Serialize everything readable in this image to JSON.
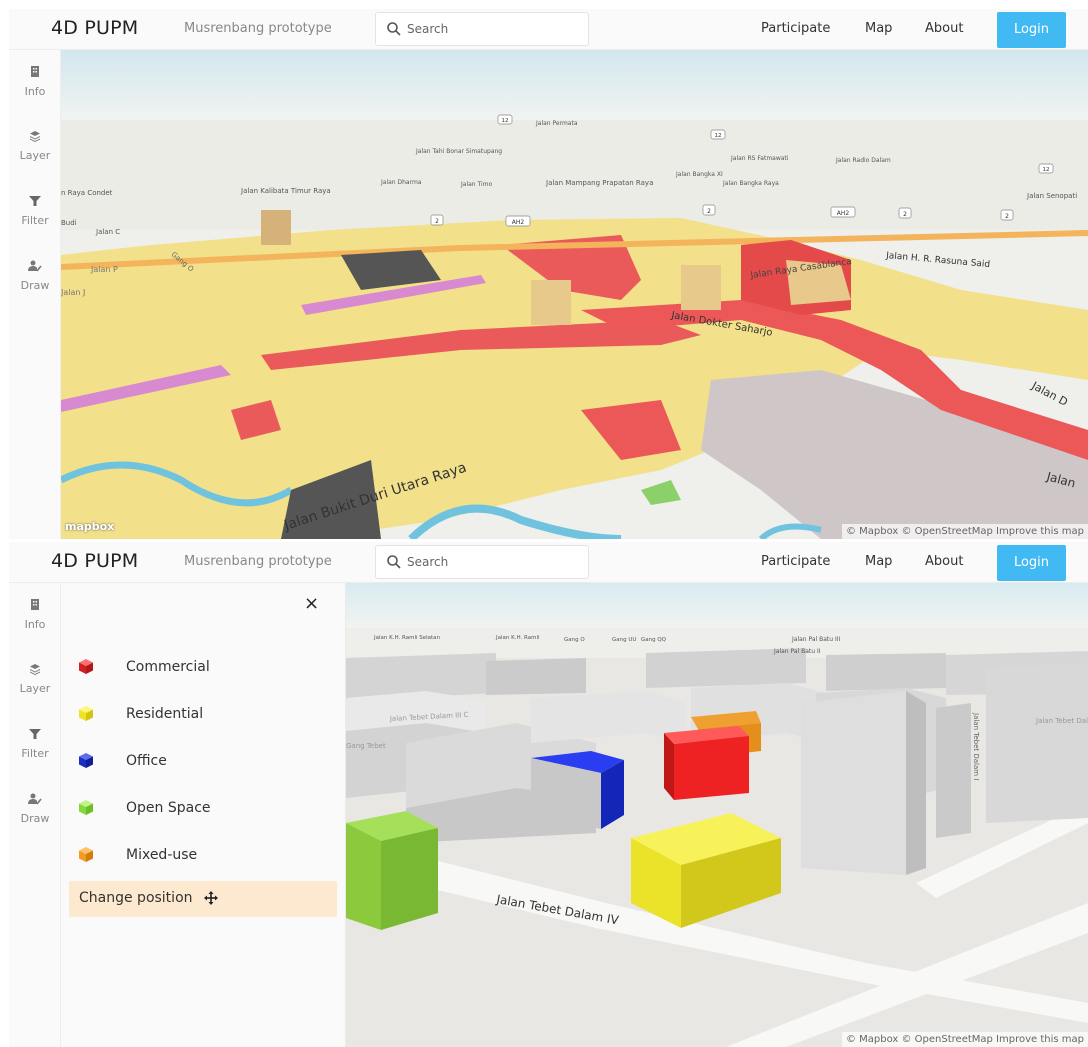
{
  "navbar": {
    "brand": "4D PUPM",
    "subtitle": "Musrenbang prototype",
    "search_placeholder": "Search",
    "links": [
      "Participate",
      "Map",
      "About"
    ],
    "login_label": "Login"
  },
  "sidebar": {
    "items": [
      {
        "label": "Info",
        "icon": "building-icon"
      },
      {
        "label": "Layer",
        "icon": "layers-icon"
      },
      {
        "label": "Filter",
        "icon": "filter-icon"
      },
      {
        "label": "Draw",
        "icon": "user-edit-icon"
      }
    ]
  },
  "map_top": {
    "street_labels": [
      "Jalan Permata",
      "Jalan Tahi Bonar Simatupang",
      "Jalan RS Fatmawati",
      "Jalan Radio Dalam",
      "Jalan Kalibata Timur Raya",
      "Jalan Dharma",
      "Jalan Timo",
      "Jalan Mampang Prapatan Raya",
      "Jalan Bangka XI",
      "Jalan Bangka Raya",
      "Jalan Senopati",
      "n Raya Condet",
      "Budi",
      "Jalan C",
      "Jalan H. R. Rasuna Said",
      "Jalan Raya Casablanca",
      "Jalan Dokter Saharjo",
      "Jalan D",
      "Jalan P",
      "Jalan J",
      "Gang O",
      "Jalan Bukit Duri Utara Raya",
      "Jalan"
    ],
    "road_shields": [
      "AH2",
      "2",
      "12"
    ],
    "logo": "mapbox",
    "attribution": "© Mapbox © OpenStreetMap Improve this map"
  },
  "legend_panel": {
    "close_label": "×",
    "items": [
      {
        "label": "Commercial",
        "color": "#e8262b"
      },
      {
        "label": "Residential",
        "color": "#f2ea2a"
      },
      {
        "label": "Office",
        "color": "#1c34c9"
      },
      {
        "label": "Open Space",
        "color": "#8fdc3a"
      },
      {
        "label": "Mixed-use",
        "color": "#f29a22"
      }
    ],
    "change_position_label": "Change position"
  },
  "map_bottom": {
    "street_labels": [
      "Jalan K.H. Ramli Selatan",
      "Jalan K.H. Ramli",
      "Gang O",
      "Gang UU",
      "Gang QQ",
      "Jalan Pal Batu III",
      "Jalan Pal Batu II",
      "Jalan Tebet Dalam III C",
      "Jalan Tebet Dalam IV",
      "Jalan Tebet Dalam",
      "Gang Tebet",
      "Jalan Tebet Dalam I"
    ],
    "attribution": "© Mapbox © OpenStreetMap Improve this map"
  }
}
